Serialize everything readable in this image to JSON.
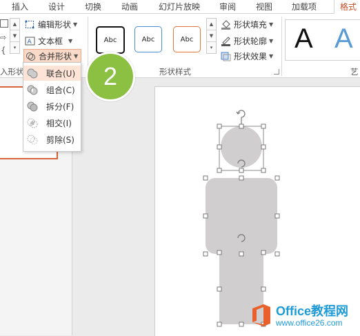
{
  "tabs": {
    "insert": "插入",
    "design": "设计",
    "transitions": "切换",
    "animations": "动画",
    "slideshow": "幻灯片放映",
    "review": "审阅",
    "view": "视图",
    "addins": "加载项",
    "format": "格式"
  },
  "ribbon": {
    "edit_shape": "编辑形状",
    "text_box": "文本框",
    "merge_shapes": "合并形状",
    "shape_fill": "形状填充",
    "shape_outline": "形状轮廓",
    "shape_effects": "形状效果",
    "insert_shapes_group": "入形状",
    "shape_styles_group": "形状样式",
    "art_group": "艺",
    "style_samples": [
      "Abc",
      "Abc",
      "Abc"
    ],
    "wordart_samples": [
      "A",
      "A"
    ]
  },
  "merge_menu": {
    "items": [
      "联合(U)",
      "组合(C)",
      "拆分(F)",
      "相交(I)",
      "剪除(S)"
    ]
  },
  "badge": "2",
  "watermark": {
    "title": "Office教程网",
    "url": "www.office26.com"
  },
  "colors": {
    "accent": "#c5502a",
    "badge": "#8cc043",
    "shape_fill": "#d0cece",
    "watermark": "#1e9ad6"
  }
}
